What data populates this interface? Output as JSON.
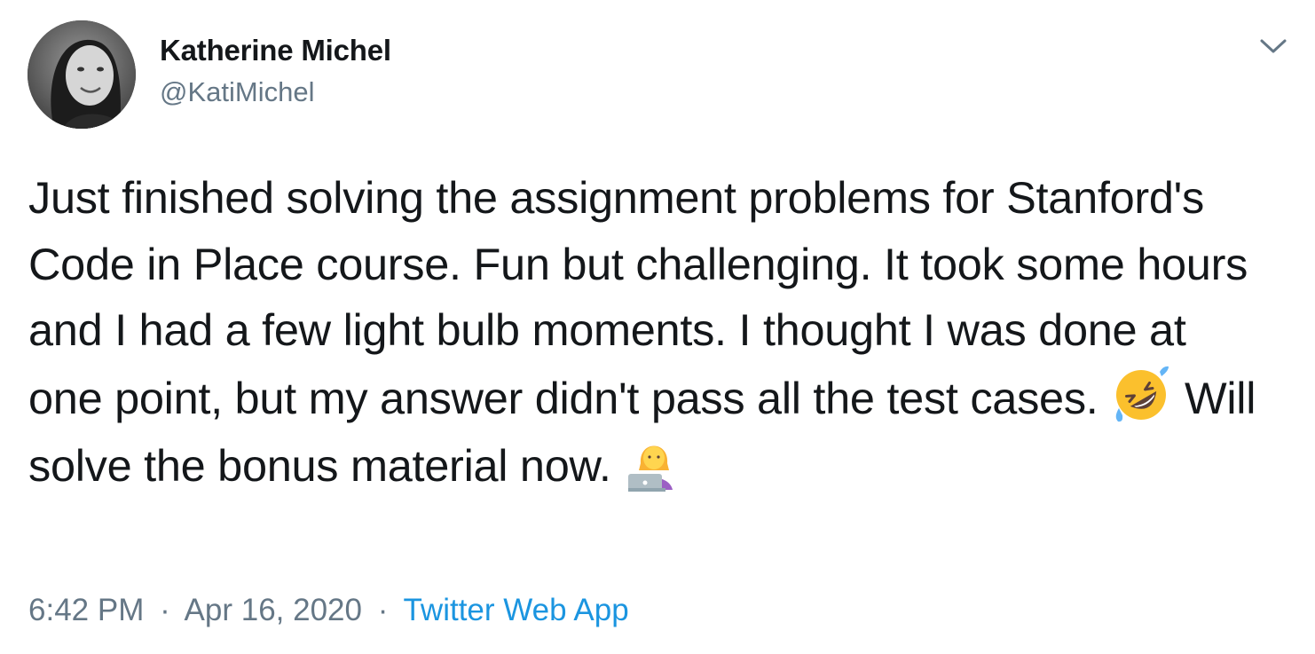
{
  "author": {
    "display_name": "Katherine Michel",
    "handle": "@KatiMichel"
  },
  "tweet": {
    "text_part1": "Just finished solving the assignment problems for Stanford's Code in Place course. Fun but challenging. It took some hours and I had a few light bulb moments. I thought I was done at one point, but my answer didn't pass all the test cases.",
    "emoji1": "rolling-on-floor-laughing-emoji",
    "text_part2": "Will solve the bonus material now.",
    "emoji2": "woman-technologist-emoji"
  },
  "meta": {
    "time": "6:42 PM",
    "separator": "·",
    "date": "Apr 16, 2020",
    "source": "Twitter Web App"
  },
  "icons": {
    "menu": "chevron-down-icon"
  },
  "colors": {
    "text": "#14171a",
    "secondary": "#657786",
    "link": "#1b95e0"
  }
}
